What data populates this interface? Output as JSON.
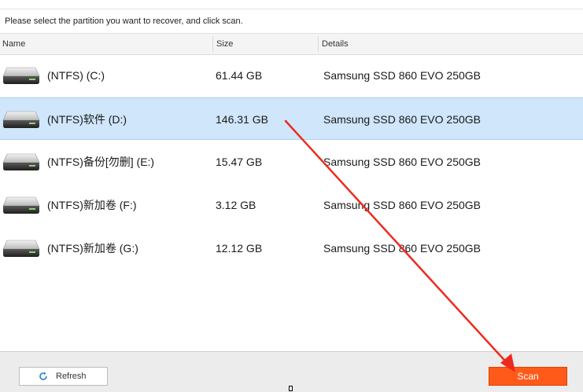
{
  "instruction": "Please select the partition you want to recover, and click scan.",
  "columns": {
    "name": "Name",
    "size": "Size",
    "details": "Details"
  },
  "partitions": [
    {
      "name": "(NTFS) (C:)",
      "size": "61.44 GB",
      "details": "Samsung SSD 860 EVO 250GB",
      "selected": false
    },
    {
      "name": "(NTFS)软件 (D:)",
      "size": "146.31 GB",
      "details": "Samsung SSD 860 EVO 250GB",
      "selected": true
    },
    {
      "name": "(NTFS)备份[勿删] (E:)",
      "size": "15.47 GB",
      "details": "Samsung SSD 860 EVO 250GB",
      "selected": false
    },
    {
      "name": "(NTFS)新加卷 (F:)",
      "size": "3.12 GB",
      "details": "Samsung SSD 860 EVO 250GB",
      "selected": false
    },
    {
      "name": "(NTFS)新加卷 (G:)",
      "size": "12.12 GB",
      "details": "Samsung SSD 860 EVO 250GB",
      "selected": false
    }
  ],
  "buttons": {
    "refresh": "Refresh",
    "scan": "Scan"
  },
  "icons": {
    "drive": "hard-drive-icon",
    "refresh": "refresh-icon"
  },
  "colors": {
    "selected_row": "#cfe6fb",
    "scan_button": "#ff5a1a",
    "annotation_arrow": "#ee2a1f"
  }
}
